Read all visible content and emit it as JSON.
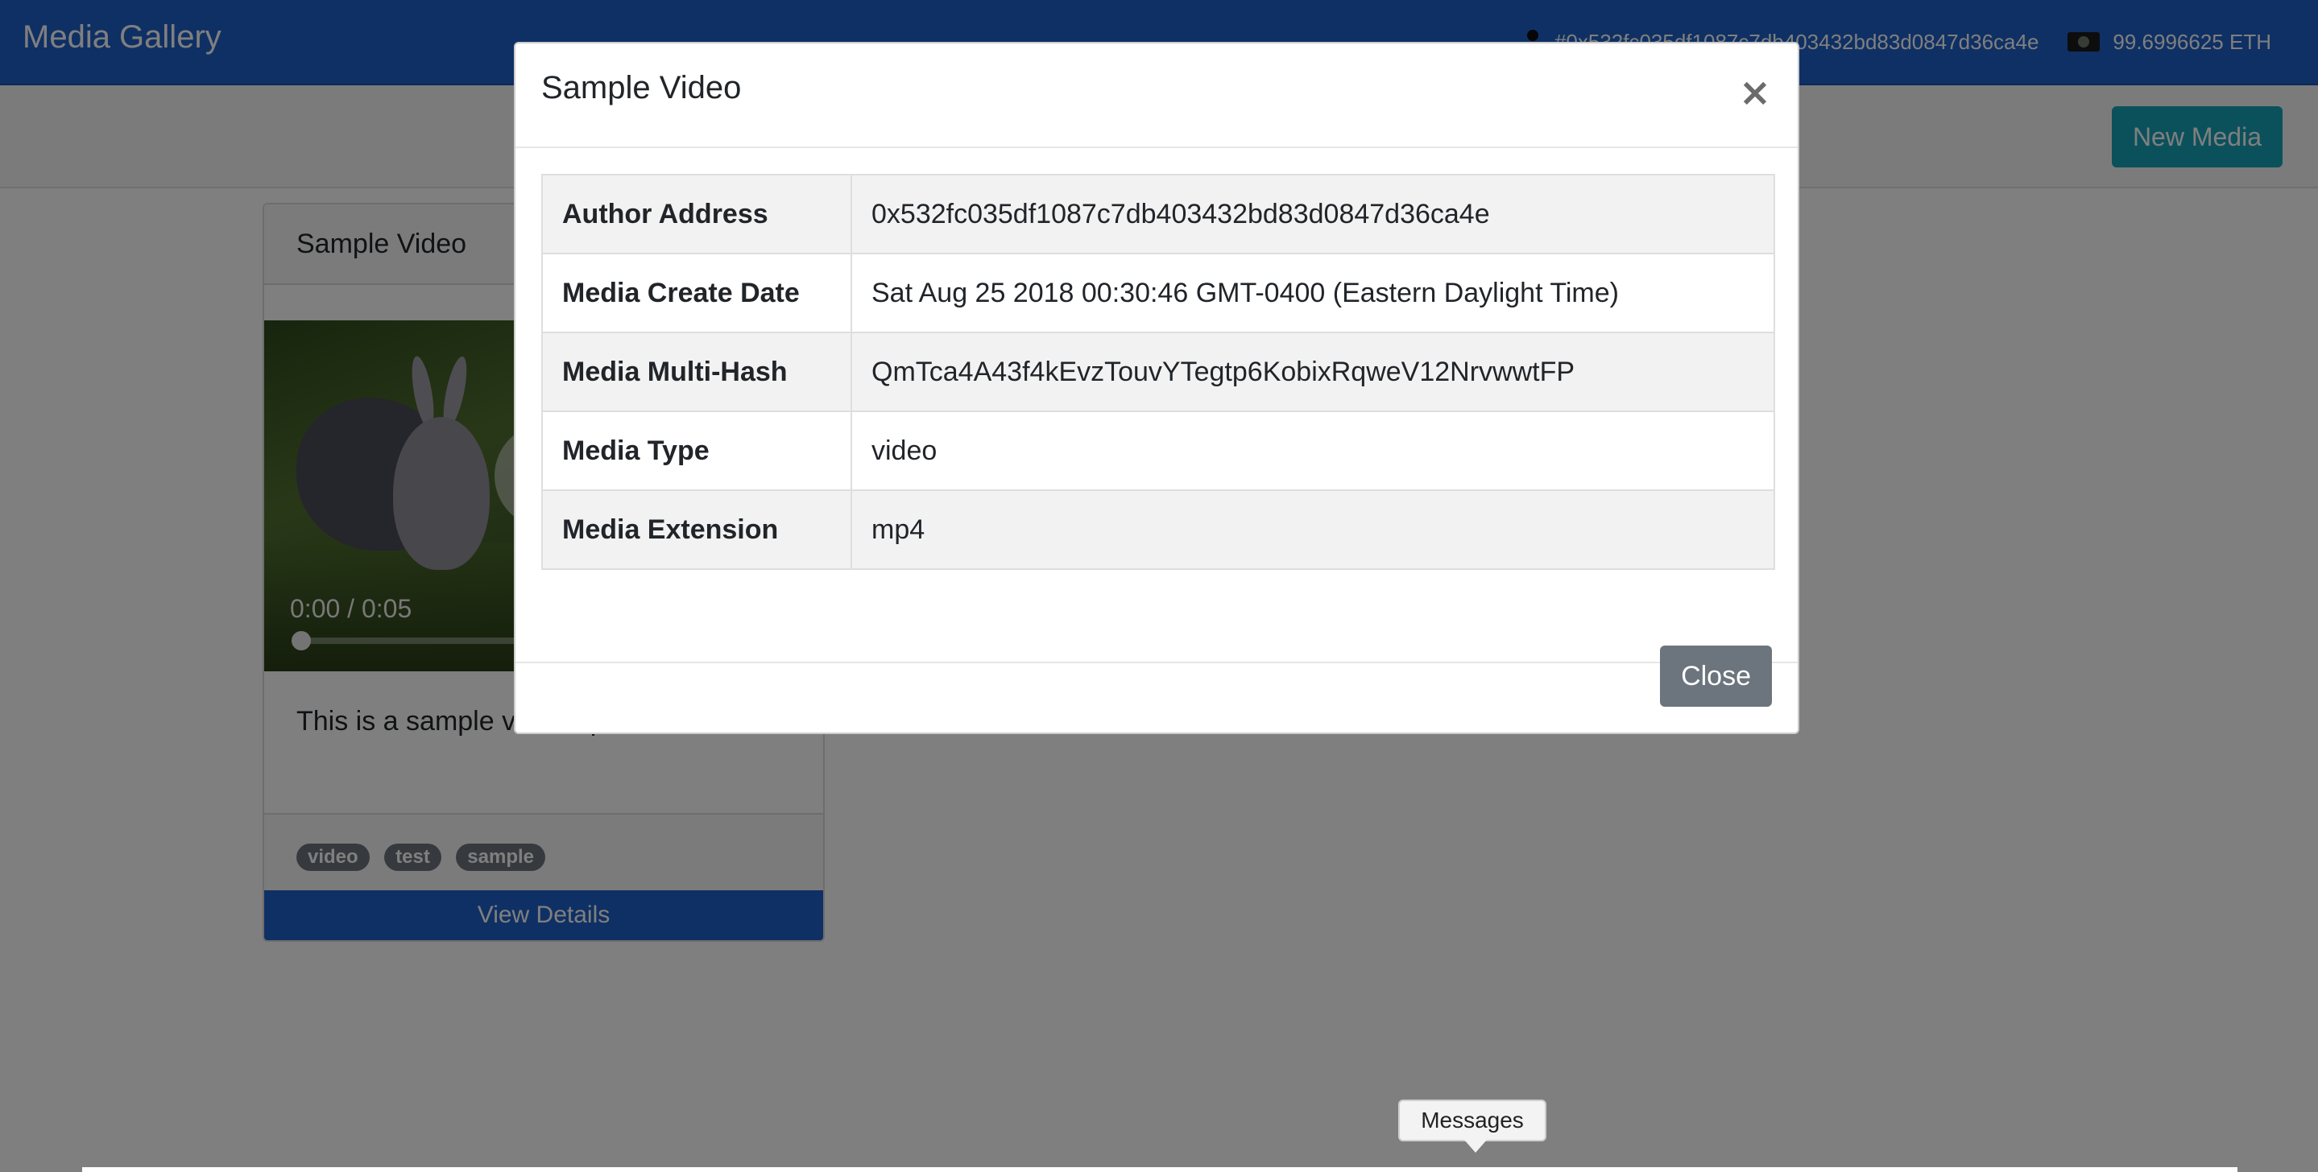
{
  "navbar": {
    "brand": "Media Gallery",
    "account_address": "#0x532fc035df1087c7db403432bd83d0847d36ca4e",
    "balance": "99.6996625 ETH"
  },
  "toolbar": {
    "new_media_label": "New Media"
  },
  "card": {
    "title": "Sample Video",
    "video_time": "0:00 / 0:05",
    "video_progress": 0,
    "description": "This is a sample video uploaded.",
    "tags": [
      "video",
      "test",
      "sample"
    ],
    "view_details_label": "View Details"
  },
  "modal": {
    "title": "Sample Video",
    "close_x": "×",
    "rows": [
      {
        "label": "Author Address",
        "value": "0x532fc035df1087c7db403432bd83d0847d36ca4e"
      },
      {
        "label": "Media Create Date",
        "value": "Sat Aug 25 2018 00:30:46 GMT-0400 (Eastern Daylight Time)"
      },
      {
        "label": "Media Multi-Hash",
        "value": "QmTca4A43f4kEvzTouvYTegtp6KobixRqweV12NrvwwtFP"
      },
      {
        "label": "Media Type",
        "value": "video"
      },
      {
        "label": "Media Extension",
        "value": "mp4"
      }
    ],
    "close_label": "Close"
  },
  "messages": {
    "label": "Messages"
  },
  "colors": {
    "navbar": "#1f61c9",
    "primary_button": "#1f61c9",
    "info_button": "#17a2b8",
    "secondary_button": "#6c757d",
    "backdrop": "rgba(0,0,0,0.5)"
  },
  "icons": {
    "account": "account-dot-icon",
    "balance": "money-icon",
    "close": "close-icon",
    "play": "play-icon"
  }
}
